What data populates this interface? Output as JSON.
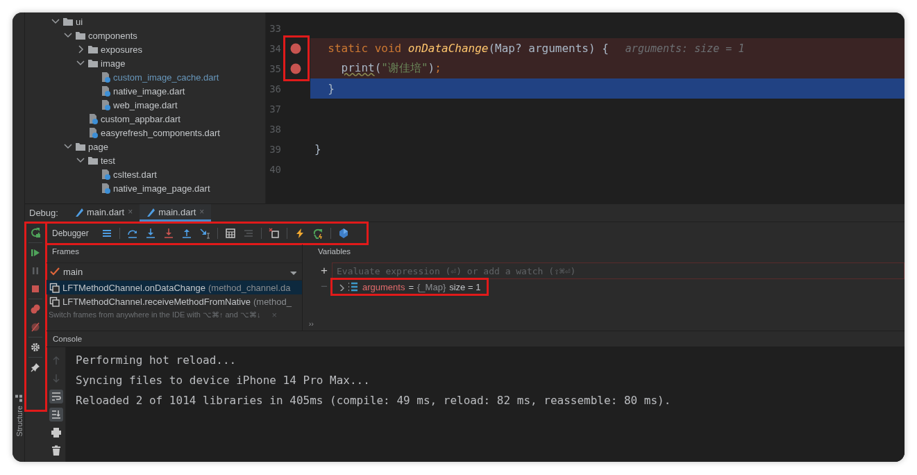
{
  "project_tree": {
    "items": [
      {
        "label": "ui",
        "kind": "folder",
        "expanded": true,
        "children": [
          {
            "label": "components",
            "kind": "folder",
            "expanded": true,
            "children": [
              {
                "label": "exposures",
                "kind": "folder",
                "expanded": false
              },
              {
                "label": "image",
                "kind": "folder",
                "expanded": true,
                "children": [
                  {
                    "label": "custom_image_cache.dart",
                    "kind": "file",
                    "modified": true
                  },
                  {
                    "label": "native_image.dart",
                    "kind": "file",
                    "modified": false
                  },
                  {
                    "label": "web_image.dart",
                    "kind": "file",
                    "modified": false
                  }
                ]
              },
              {
                "label": "custom_appbar.dart",
                "kind": "file",
                "modified": false
              },
              {
                "label": "easyrefresh_components.dart",
                "kind": "file",
                "modified": false
              }
            ]
          },
          {
            "label": "page",
            "kind": "folder",
            "expanded": true,
            "children": [
              {
                "label": "test",
                "kind": "folder",
                "expanded": true,
                "children": [
                  {
                    "label": "csltest.dart",
                    "kind": "file",
                    "modified": false
                  },
                  {
                    "label": "native_image_page.dart",
                    "kind": "file",
                    "modified": false
                  }
                ]
              }
            ]
          }
        ]
      }
    ]
  },
  "editor": {
    "breakpoints_highlighted": true,
    "lines": [
      {
        "number": "33",
        "breakpoint": false,
        "current": false
      },
      {
        "number": "34",
        "breakpoint": true,
        "current": false,
        "tokens": [
          {
            "kind": "keyword",
            "text": "  static void "
          },
          {
            "kind": "function",
            "text": "onDataChange"
          },
          {
            "kind": "plain",
            "text": "(Map? arguments) {"
          }
        ],
        "hint": "arguments: size = 1"
      },
      {
        "number": "35",
        "breakpoint": true,
        "current": false,
        "tokens": [
          {
            "kind": "warning",
            "text": "    print"
          },
          {
            "kind": "plain",
            "text": "("
          },
          {
            "kind": "string",
            "text": "\"谢佳培\""
          },
          {
            "kind": "plain",
            "text": ")"
          },
          {
            "kind": "keyword",
            "text": ";"
          }
        ]
      },
      {
        "number": "36",
        "breakpoint": false,
        "current": true,
        "tokens": [
          {
            "kind": "plain",
            "text": "  }"
          }
        ]
      },
      {
        "number": "37",
        "breakpoint": false,
        "current": false
      },
      {
        "number": "38",
        "breakpoint": false,
        "current": false
      },
      {
        "number": "39",
        "breakpoint": false,
        "current": false,
        "tokens": [
          {
            "kind": "plain",
            "text": "}"
          }
        ]
      },
      {
        "number": "40",
        "breakpoint": false,
        "current": false
      }
    ]
  },
  "debug": {
    "label": "Debug:",
    "tabs": [
      {
        "label": "main.dart",
        "close": "×",
        "selected": false
      },
      {
        "label": "main.dart",
        "close": "×",
        "selected": true
      }
    ],
    "side_toolbar": {
      "highlighted": true
    },
    "toolbar": {
      "label": "Debugger",
      "highlighted": true
    },
    "frames": {
      "title": "Frames",
      "thread": "main",
      "rows": [
        {
          "method": "LFTMethodChannel.onDataChange",
          "location": "(method_channel.da",
          "selected": true
        },
        {
          "method": "LFTMethodChannel.receiveMethodFromNative",
          "location": "(method_",
          "selected": false
        }
      ],
      "hint": "Switch frames from anywhere in the IDE with ⌥⌘↑ and ⌥⌘↓",
      "hint_close": "×",
      "more": "››"
    },
    "variables": {
      "title": "Variables",
      "add": "+",
      "remove": "−",
      "placeholder": "Evaluate expression (⏎) or add a watch (⇧⌘⏎)",
      "items": [
        {
          "name": "arguments",
          "separator": "=",
          "type": "{_Map}",
          "value": "size = 1",
          "expanded": false,
          "highlighted": true
        }
      ]
    }
  },
  "console": {
    "title": "Console",
    "soft_wrap": true,
    "scroll_to_end": true,
    "lines": [
      "Performing hot reload...",
      "Syncing files to device iPhone 14 Pro Max...",
      "Reloaded 2 of 1014 libraries in 405ms (compile: 49 ms, reload: 82 ms, reassemble: 80 ms)."
    ]
  },
  "structure_tab": "Structure"
}
